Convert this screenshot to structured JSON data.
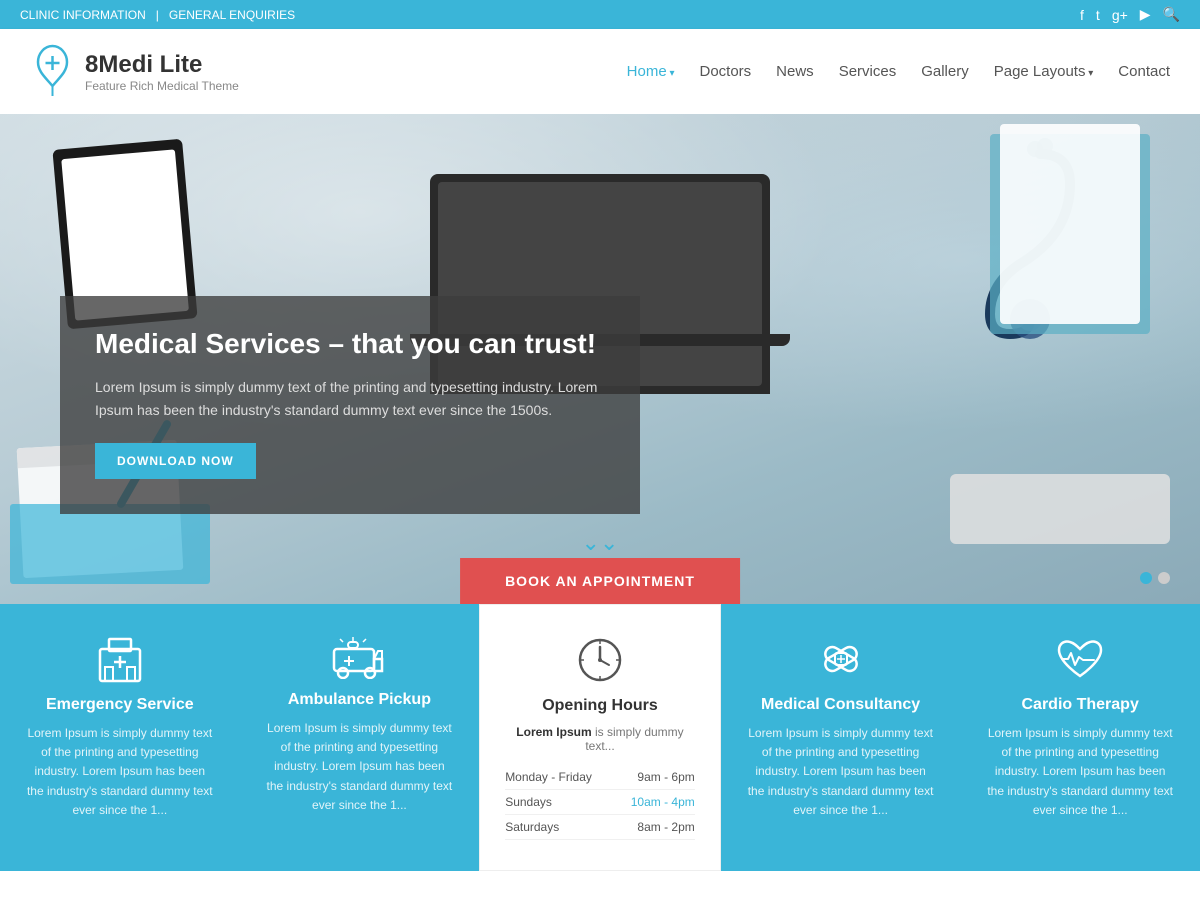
{
  "topbar": {
    "left": [
      "CLINIC INFORMATION",
      "|",
      "GENERAL ENQUIRIES"
    ],
    "icons": [
      "facebook",
      "twitter",
      "google-plus",
      "youtube",
      "search"
    ]
  },
  "header": {
    "logo": {
      "name": "8Medi Lite",
      "tagline": "Feature Rich Medical Theme"
    },
    "nav": [
      {
        "label": "Home",
        "active": true,
        "hasDropdown": true
      },
      {
        "label": "Doctors",
        "active": false,
        "hasDropdown": false
      },
      {
        "label": "News",
        "active": false,
        "hasDropdown": false
      },
      {
        "label": "Services",
        "active": false,
        "hasDropdown": false
      },
      {
        "label": "Gallery",
        "active": false,
        "hasDropdown": false
      },
      {
        "label": "Page Layouts",
        "active": false,
        "hasDropdown": true
      },
      {
        "label": "Contact",
        "active": false,
        "hasDropdown": false
      }
    ]
  },
  "hero": {
    "title": "Medical Services – that you can trust!",
    "description": "Lorem Ipsum is simply dummy text of the printing and typesetting industry. Lorem Ipsum has been the industry's standard dummy text ever since the 1500s.",
    "cta_button": "DOWNLOAD NOW",
    "appointment_button": "BOOK AN APPOINTMENT",
    "slider_dots": [
      {
        "active": true
      },
      {
        "active": false
      }
    ]
  },
  "services": [
    {
      "id": "emergency",
      "icon": "hospital",
      "title": "Emergency Service",
      "desc": "Lorem Ipsum is simply dummy text of the printing and typesetting industry. Lorem Ipsum has been the industry's standard dummy text ever since the 1...",
      "theme": "blue"
    },
    {
      "id": "ambulance",
      "icon": "ambulance",
      "title": "Ambulance Pickup",
      "desc": "Lorem Ipsum is simply dummy text of the printing and typesetting industry. Lorem Ipsum has been the industry's standard dummy text ever since the 1...",
      "theme": "blue"
    },
    {
      "id": "opening-hours",
      "icon": "clock",
      "title": "Opening Hours",
      "intro_bold": "Lorem Ipsum",
      "intro_rest": " is simply dummy text...",
      "hours": [
        {
          "day": "Monday - Friday",
          "time": "9am - 6pm",
          "highlight": false
        },
        {
          "day": "Sundays",
          "time": "10am - 4pm",
          "highlight": true
        },
        {
          "day": "Saturdays",
          "time": "8am - 2pm",
          "highlight": false
        }
      ],
      "theme": "white"
    },
    {
      "id": "consultancy",
      "icon": "bandaid",
      "title": "Medical Consultancy",
      "desc": "Lorem Ipsum is simply dummy text of the printing and typesetting industry. Lorem Ipsum has been the industry's standard dummy text ever since the 1...",
      "theme": "blue"
    },
    {
      "id": "cardio",
      "icon": "heartbeat",
      "title": "Cardio Therapy",
      "desc": "Lorem Ipsum is simply dummy text of the printing and typesetting industry. Lorem Ipsum has been the industry's standard dummy text ever since the 1...",
      "theme": "blue"
    }
  ],
  "colors": {
    "primary": "#3ab5d8",
    "accent": "#e05050",
    "dark": "#333333",
    "light_blue_bg": "#3ab5d8"
  }
}
